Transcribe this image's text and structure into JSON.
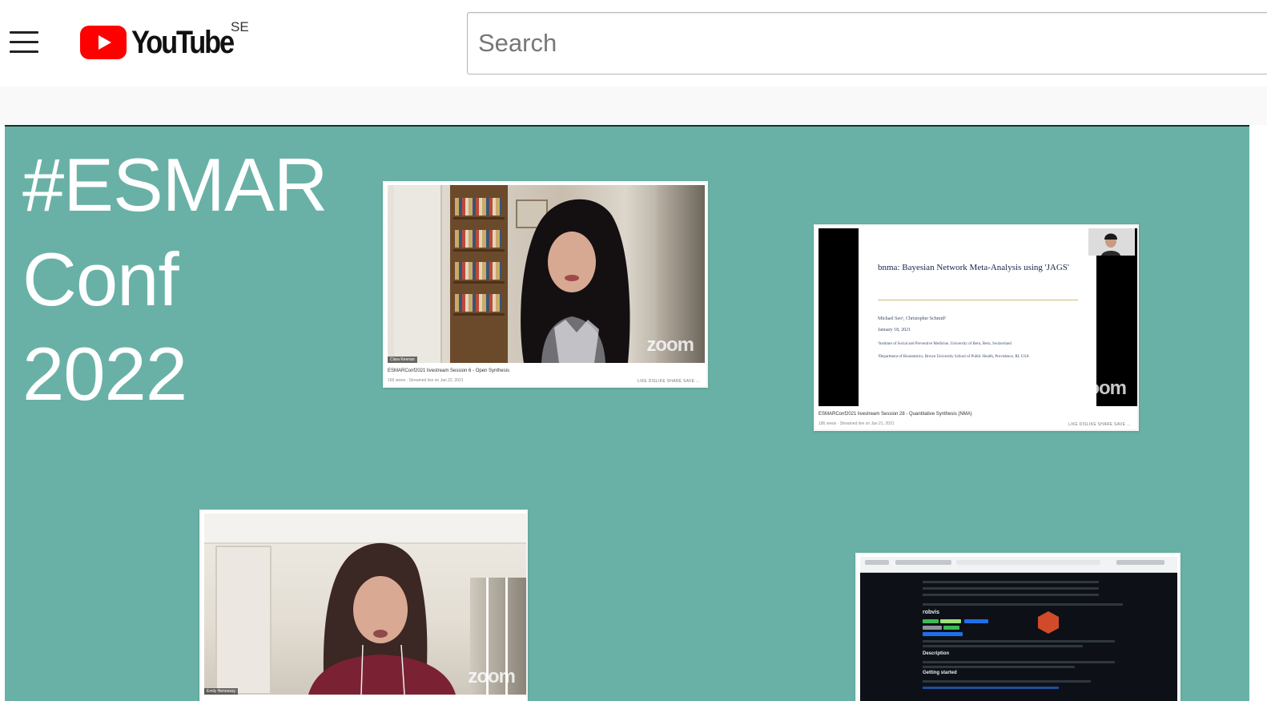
{
  "header": {
    "logo_text": "YouTube",
    "country_code": "SE",
    "search_placeholder": "Search"
  },
  "player": {
    "background_color": "#69b1a6",
    "title_lines": [
      "#ESMAR",
      "Conf",
      "2022"
    ],
    "thumbnails": [
      {
        "id": "session-6",
        "name_tag": "Clara Keenan",
        "caption": "ESMARConf2021 livestream Session 6 - Open Synthesis",
        "subcaption": "166 views · Streamed live on Jan 22, 2021",
        "actions": "LIKE   DISLIKE   SHARE   SAVE   ...",
        "watermark": "zoom"
      },
      {
        "id": "session-28",
        "slide_title": "bnma: Bayesian Network Meta-Analysis using 'JAGS'",
        "slide_authors": "Michael Seo¹, Christopher Schmid²",
        "slide_date": "January 18, 2021",
        "slide_affil_1": "¹Institute of Social and Preventive Medicine, University of Bern, Bern, Switzerland",
        "slide_affil_2": "²Department of Biostatistics, Brown University School of Public Health, Providence, RI, USA",
        "caption": "ESMARConf2021 livestream Session 28 - Quantitative Synthesis (NMA)",
        "subcaption": "186 views · Streamed live on Jan 21, 2021",
        "actions": "LIKE   DISLIKE   SHARE   SAVE   ...",
        "watermark": "zoom"
      },
      {
        "id": "session-speaker",
        "name_tag": "Emily Hennessy",
        "watermark": "zoom"
      },
      {
        "id": "session-screen",
        "repo_name": "robvis",
        "section_description": "Description",
        "section_getting_started": "Getting started"
      }
    ]
  }
}
